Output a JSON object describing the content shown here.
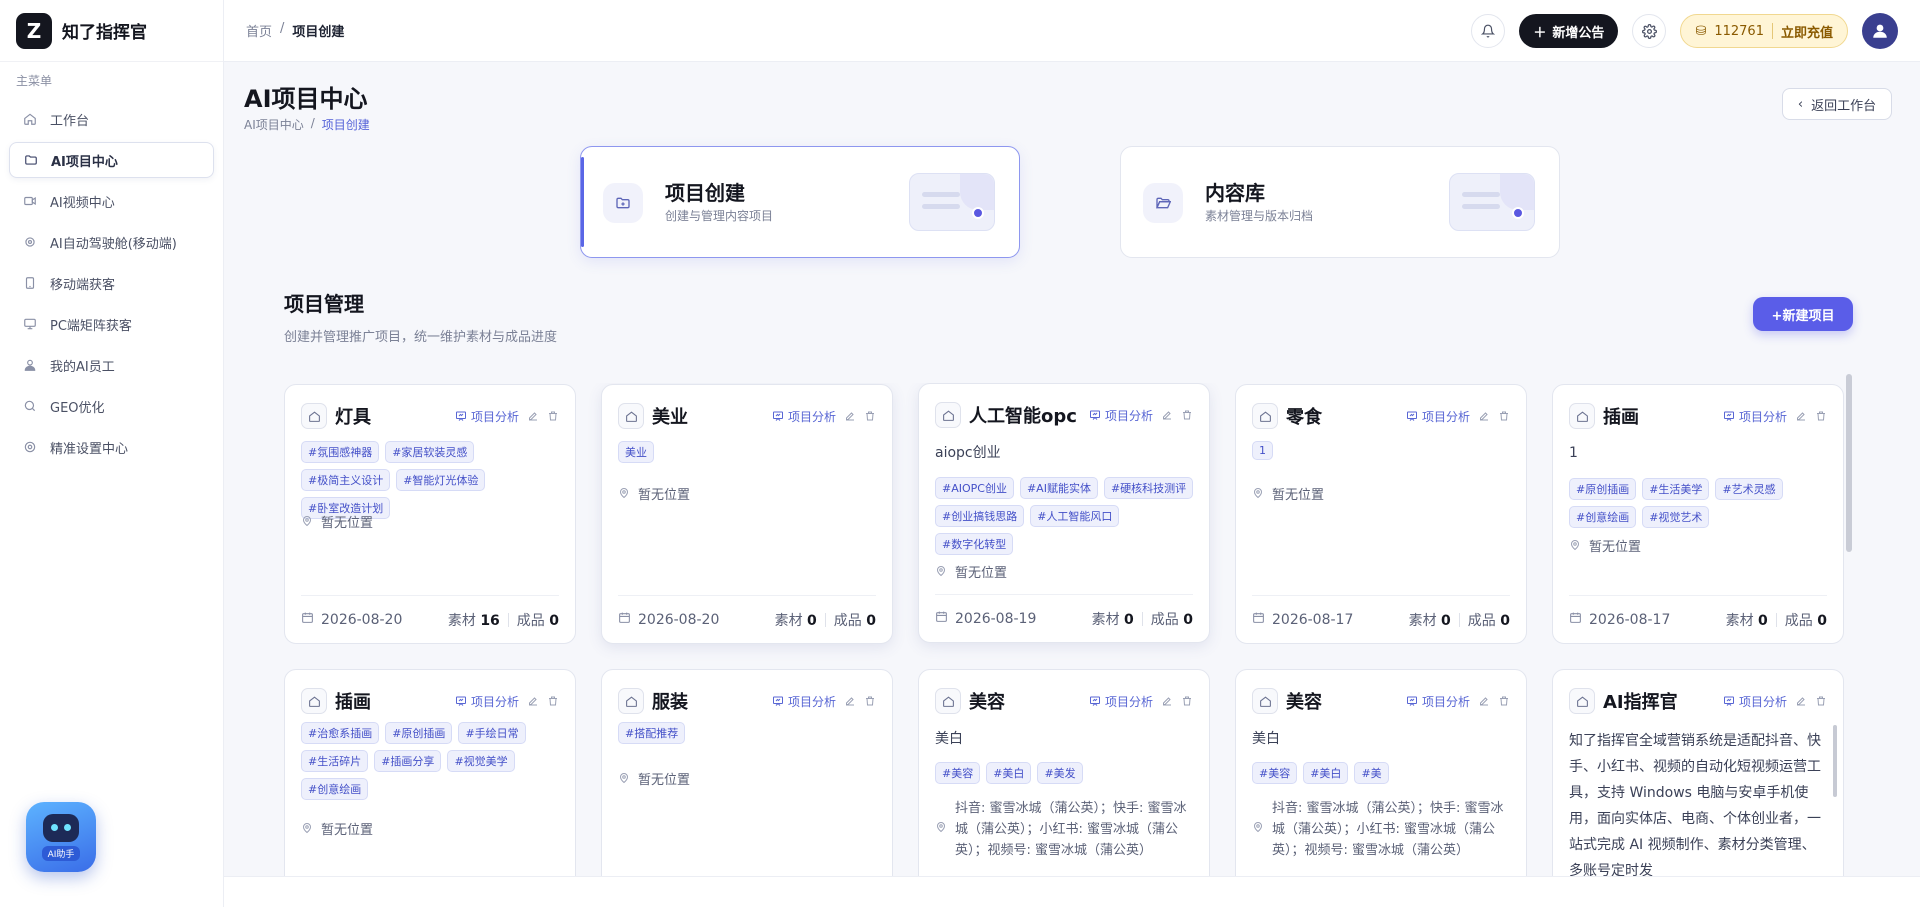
{
  "brand": {
    "name": "知了指挥官",
    "logo_char": "Z"
  },
  "sidebar": {
    "menu_title": "主菜单",
    "items": [
      {
        "label": "工作台",
        "icon": "home-icon",
        "active": false
      },
      {
        "label": "AI项目中心",
        "icon": "folder-icon",
        "active": true
      },
      {
        "label": "AI视频中心",
        "icon": "video-icon",
        "active": false
      },
      {
        "label": "AI自动驾驶舱(移动端)",
        "icon": "cog-circle-icon",
        "active": false
      },
      {
        "label": "移动端获客",
        "icon": "phone-icon",
        "active": false
      },
      {
        "label": "PC端矩阵获客",
        "icon": "monitor-icon",
        "active": false
      },
      {
        "label": "我的AI员工",
        "icon": "user-icon",
        "active": false
      },
      {
        "label": "GEO优化",
        "icon": "search-icon",
        "active": false
      },
      {
        "label": "精准设置中心",
        "icon": "gear-icon",
        "active": false
      }
    ],
    "ai_helper_label": "AI助手"
  },
  "topbar": {
    "breadcrumb": [
      "首页",
      "项目创建"
    ],
    "new_notice": "新增公告",
    "credits": "112761",
    "recharge": "立即充值"
  },
  "page": {
    "title": "AI项目中心",
    "breadcrumb": [
      "AI项目中心",
      "项目创建"
    ],
    "back_label": "返回工作台"
  },
  "entries": [
    {
      "title": "项目创建",
      "desc": "创建与管理内容项目",
      "active": true
    },
    {
      "title": "内容库",
      "desc": "素材管理与版本归档",
      "active": false
    }
  ],
  "section": {
    "title": "项目管理",
    "desc": "创建并管理推广项目，统一维护素材与成品进度",
    "new_label": "+新建项目"
  },
  "card_labels": {
    "analysis": "项目分析",
    "material": "素材",
    "product": "成品"
  },
  "projects": [
    {
      "name": "灯具",
      "sub": "",
      "tags": [
        "#氛围感神器",
        "#家居软装灵感",
        "#极简主义设计",
        "#智能灯光体验",
        "#卧室改造计划"
      ],
      "location": "暂无位置",
      "date": "2026-08-20",
      "material": "16",
      "product": "0"
    },
    {
      "name": "美业",
      "sub": "",
      "tags": [
        "美业"
      ],
      "location": "暂无位置",
      "date": "2026-08-20",
      "material": "0",
      "product": "0"
    },
    {
      "name": "人工智能opc",
      "sub": "aiopc创业",
      "tags": [
        "#AIOPC创业",
        "#AI赋能实体",
        "#硬核科技测评",
        "#创业搞钱思路",
        "#人工智能风口",
        "#数字化转型"
      ],
      "location": "暂无位置",
      "date": "2026-08-19",
      "material": "0",
      "product": "0"
    },
    {
      "name": "零食",
      "sub": "",
      "tags": [
        "1"
      ],
      "location": "暂无位置",
      "date": "2026-08-17",
      "material": "0",
      "product": "0"
    },
    {
      "name": "插画",
      "sub": "1",
      "tags": [
        "#原创插画",
        "#生活美学",
        "#艺术灵感",
        "#创意绘画",
        "#视觉艺术"
      ],
      "location": "暂无位置",
      "date": "2026-08-17",
      "material": "0",
      "product": "0"
    },
    {
      "name": "插画",
      "sub": "",
      "tags": [
        "#治愈系插画",
        "#原创插画",
        "#手绘日常",
        "#生活碎片",
        "#插画分享",
        "#视觉美学",
        "#创意绘画"
      ],
      "location": "暂无位置"
    },
    {
      "name": "服装",
      "sub": "",
      "tags": [
        "#搭配推荐"
      ],
      "location": "暂无位置"
    },
    {
      "name": "美容",
      "sub": "美白",
      "tags": [
        "#美容",
        "#美白",
        "#美发"
      ],
      "location": "抖音: 蜜雪冰城（蒲公英）；快手: 蜜雪冰城（蒲公英）；小红书: 蜜雪冰城（蒲公英）；视频号: 蜜雪冰城（蒲公英）"
    },
    {
      "name": "美容",
      "sub": "美白",
      "tags": [
        "#美容",
        "#美白",
        "#美"
      ],
      "location": "抖音: 蜜雪冰城（蒲公英）；快手: 蜜雪冰城（蒲公英）；小红书: 蜜雪冰城（蒲公英）；视频号: 蜜雪冰城（蒲公英）"
    },
    {
      "name": "AI指挥官",
      "desc": "知了指挥官全域营销系统是适配抖音、快手、小红书、视频的自动化短视频运营工具，支持 Windows 电脑与安卓手机使用，面向实体店、电商、个体创业者，一站式完成 AI 视频制作、素材分类管理、多账号定时发"
    }
  ]
}
